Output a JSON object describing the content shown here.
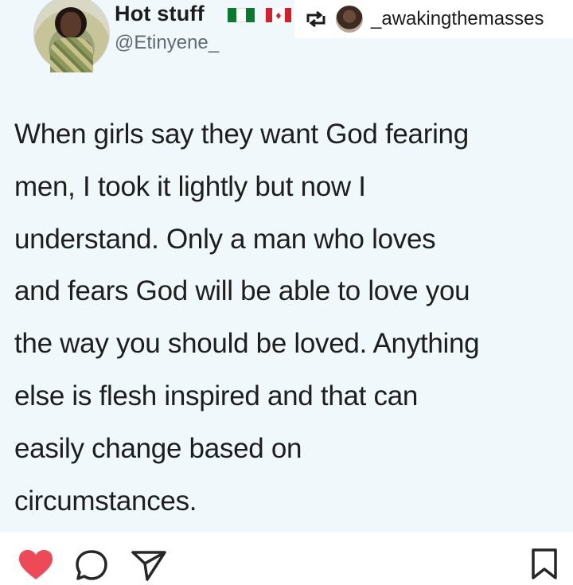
{
  "tweet": {
    "display_name": "Hot stuff",
    "handle": "@Etinyene_",
    "flags": [
      "nigeria-flag",
      "canada-flag"
    ],
    "lines": [
      "When girls say they want God fearing",
      "men, I took it lightly but now I",
      "understand. Only a man who loves",
      "and fears God will be able to love you",
      "the way you should be loved. Anything",
      "else is flesh inspired and that can",
      "easily change based on",
      "circumstances."
    ]
  },
  "repost": {
    "icon": "repost-icon",
    "username": "_awakingthemasses"
  },
  "actions": {
    "icons": [
      "heart-icon",
      "comment-icon",
      "share-icon",
      "bookmark-icon"
    ],
    "liked": true
  },
  "colors": {
    "post_background": "#f0f8fb",
    "like_red": "#ed4956"
  }
}
